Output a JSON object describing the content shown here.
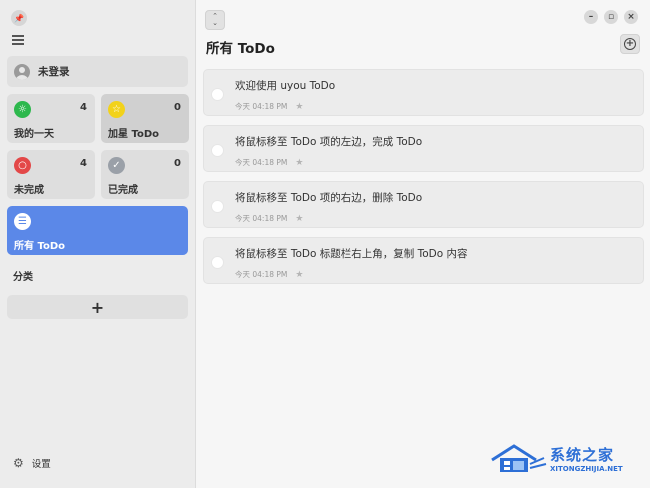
{
  "sidebar": {
    "login_label": "未登录",
    "lists": [
      {
        "label": "我的一天",
        "count": "4",
        "icon": "sun-icon",
        "color": "#2db84d"
      },
      {
        "label": "加星 ToDo",
        "count": "0",
        "icon": "star-icon",
        "color": "#f2d21b"
      },
      {
        "label": "未完成",
        "count": "4",
        "icon": "circle-icon",
        "color": "#e34848"
      },
      {
        "label": "已完成",
        "count": "0",
        "icon": "check-icon",
        "color": "#9aa0a8"
      }
    ],
    "all_label": "所有 ToDo",
    "category_label": "分类",
    "add_category": "+",
    "settings_label": "设置",
    "active_color": "#5b88e8"
  },
  "main": {
    "title": "所有 ToDo",
    "todos": [
      {
        "text": "欢迎使用 uyou ToDo",
        "time": "今天 04:18 PM"
      },
      {
        "text": "将鼠标移至 ToDo 项的左边，完成 ToDo",
        "time": "今天 04:18 PM"
      },
      {
        "text": "将鼠标移至 ToDo 项的右边，删除 ToDo",
        "time": "今天 04:18 PM"
      },
      {
        "text": "将鼠标移至 ToDo 标题栏右上角，复制 ToDo 内容",
        "time": "今天 04:18 PM"
      }
    ]
  },
  "watermark": {
    "title": "系统之家",
    "subtitle": "XITONGZHIJIA.NET"
  }
}
